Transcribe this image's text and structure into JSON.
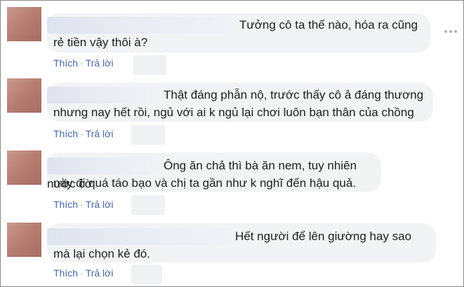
{
  "comments": [
    {
      "line1": "Tưởng cô ta thế nào, hóa ra cũng",
      "line2": "rẻ tiền vậy thôi à?",
      "like": "Thích",
      "reply": "Trả lời"
    },
    {
      "line1": "Thật đáng phẫn nộ, trước thấy cô ả đáng thương",
      "line2": "nhưng nay hết rồi, ngủ với ai k ngủ lại chơi luôn bạn thân của chồng",
      "like": "Thích",
      "reply": "Trả lời"
    },
    {
      "line1": "Ông ăn chả thì bà ăn nem, tuy nhiên nước cờ",
      "line2": "này đi quá táo bạo và chị ta gần như k nghĩ đến hậu quả.",
      "like": "Thích",
      "reply": "Trả lời"
    },
    {
      "line1": "Hết người để lên giường hay sao",
      "line2": "mà lại chọn kẻ đó.",
      "like": "Thích",
      "reply": "Trả lời"
    }
  ],
  "icons": {
    "more": "more-options-icon",
    "avatar": "avatar"
  }
}
